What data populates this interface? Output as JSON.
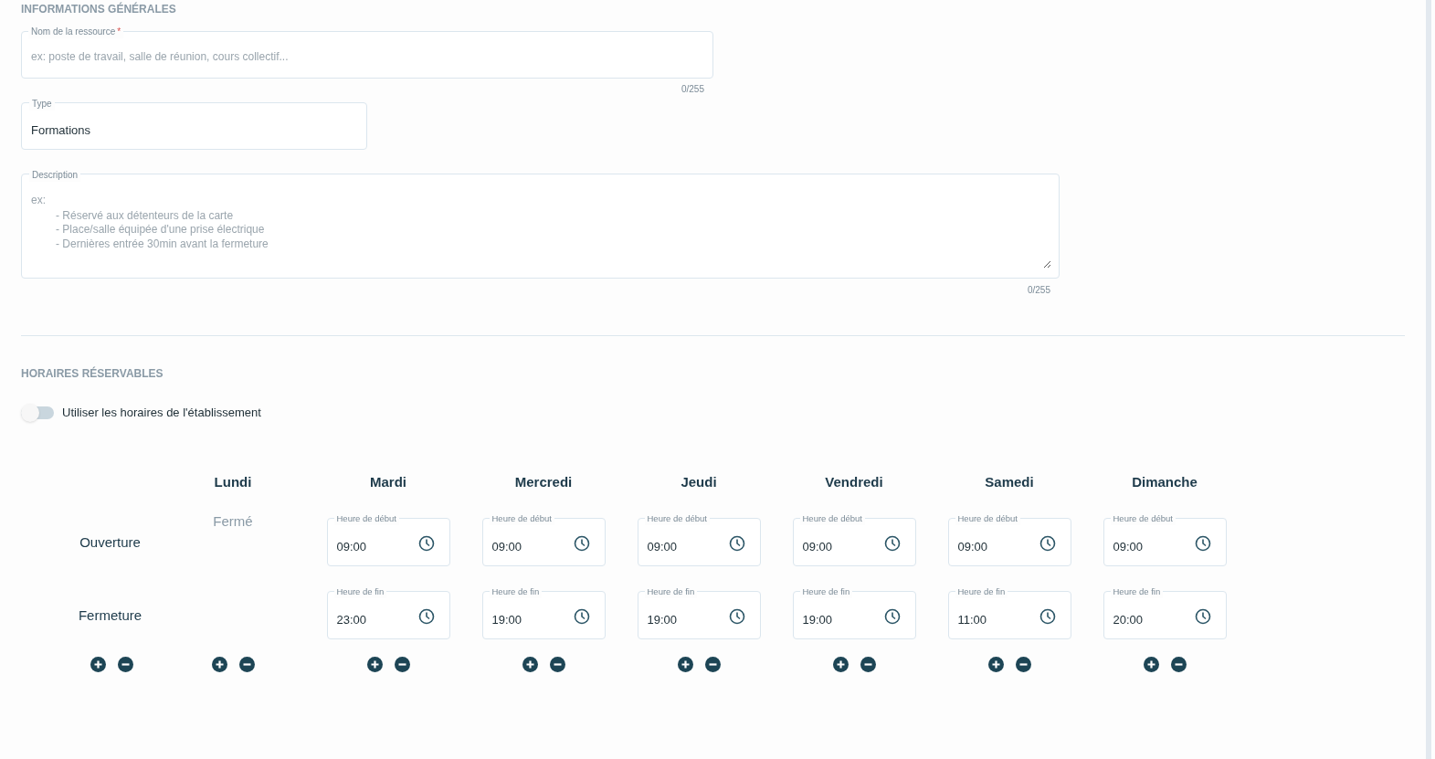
{
  "general": {
    "title": "INFORMATIONS GÉNÉRALES",
    "name_field": {
      "label": "Nom de la ressource",
      "required_mark": "*",
      "placeholder": "ex: poste de travail, salle de réunion, cours collectif...",
      "counter": "0/255"
    },
    "type_field": {
      "label": "Type",
      "value": "Formations"
    },
    "description_field": {
      "label": "Description",
      "placeholder_lines": [
        "ex:",
        "- Réservé aux détenteurs de la carte",
        "- Place/salle équipée d'une prise électrique",
        "- Dernières entrée 30min avant la fermeture"
      ],
      "counter": "0/255"
    }
  },
  "schedule": {
    "title": "HORAIRES RÉSERVABLES",
    "toggle": {
      "label": "Utiliser les horaires de l'établissement",
      "on": false
    },
    "row_labels": [
      "Ouverture",
      "Fermeture"
    ],
    "days": [
      {
        "name": "Lundi",
        "closed": true,
        "closed_label": "Fermé"
      },
      {
        "name": "Mardi",
        "closed": false,
        "start": {
          "label": "Heure de début",
          "value": "09:00"
        },
        "end": {
          "label": "Heure de fin",
          "value": "23:00"
        }
      },
      {
        "name": "Mercredi",
        "closed": false,
        "start": {
          "label": "Heure de début",
          "value": "09:00"
        },
        "end": {
          "label": "Heure de fin",
          "value": "19:00"
        }
      },
      {
        "name": "Jeudi",
        "closed": false,
        "start": {
          "label": "Heure de début",
          "value": "09:00"
        },
        "end": {
          "label": "Heure de fin",
          "value": "19:00"
        }
      },
      {
        "name": "Vendredi",
        "closed": false,
        "start": {
          "label": "Heure de début",
          "value": "09:00"
        },
        "end": {
          "label": "Heure de fin",
          "value": "19:00"
        }
      },
      {
        "name": "Samedi",
        "closed": false,
        "start": {
          "label": "Heure de début",
          "value": "09:00"
        },
        "end": {
          "label": "Heure de fin",
          "value": "11:00"
        }
      },
      {
        "name": "Dimanche",
        "closed": false,
        "start": {
          "label": "Heure de début",
          "value": "09:00"
        },
        "end": {
          "label": "Heure de fin",
          "value": "20:00"
        }
      }
    ]
  }
}
